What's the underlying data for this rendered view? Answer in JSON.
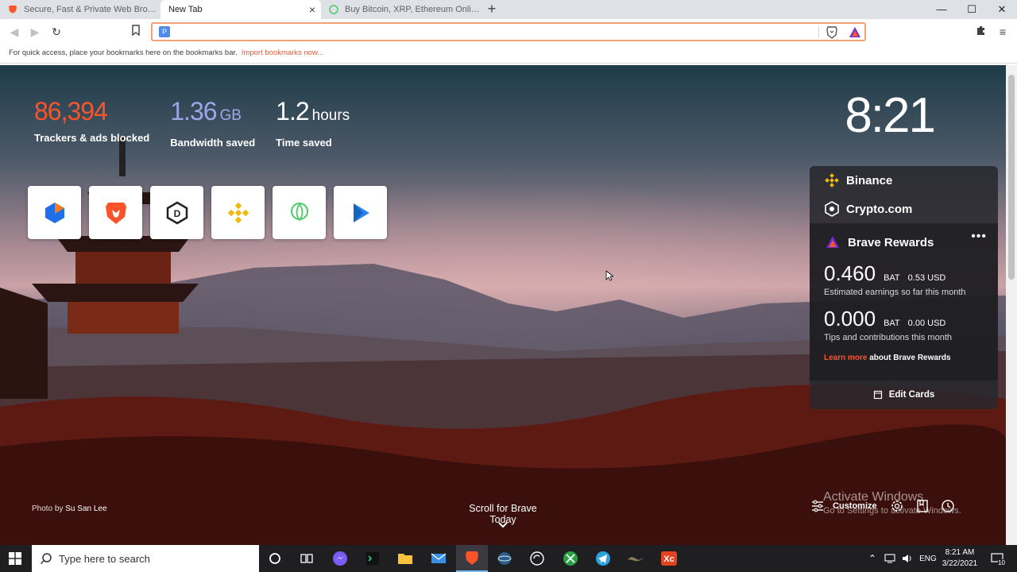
{
  "tabs": [
    {
      "title": "Secure, Fast & Private Web Browser w",
      "active": false,
      "icon": "brave-lion-icon"
    },
    {
      "title": "New Tab",
      "active": true,
      "icon": ""
    },
    {
      "title": "Buy Bitcoin, XRP, Ethereum Online - U",
      "active": false,
      "icon": "uphold-icon"
    }
  ],
  "window_controls": {
    "minimize": "—",
    "maximize": "☐",
    "close": "✕"
  },
  "omnibox": {
    "value": "",
    "placeholder": ""
  },
  "bookmarks_bar": {
    "message": "For quick access, place your bookmarks here on the bookmarks bar.",
    "import_link": "Import bookmarks now..."
  },
  "stats": {
    "trackers": {
      "value": "86,394",
      "label": "Trackers & ads blocked",
      "color": "#fb542b"
    },
    "bandwidth": {
      "value": "1.36",
      "unit": "GB",
      "label": "Bandwidth saved",
      "color": "#a0a5eb"
    },
    "time": {
      "value": "1.2",
      "unit": "hours",
      "label": "Time saved",
      "color": "#ffffff"
    }
  },
  "clock": "8:21",
  "top_sites": [
    {
      "name": "crypto-exchange-icon"
    },
    {
      "name": "brave-icon"
    },
    {
      "name": "dapp-icon"
    },
    {
      "name": "binance-icon"
    },
    {
      "name": "uphold-icon"
    },
    {
      "name": "play-icon"
    }
  ],
  "cards": {
    "binance": "Binance",
    "crypto": "Crypto.com",
    "rewards": {
      "title": "Brave Rewards",
      "more": "•••",
      "earnings_amount": "0.460",
      "earnings_currency": "BAT",
      "earnings_usd": "0.53 USD",
      "earnings_note": "Estimated earnings so far this month",
      "tips_amount": "0.000",
      "tips_currency": "BAT",
      "tips_usd": "0.00 USD",
      "tips_note": "Tips and contributions this month",
      "learn_more": "Learn more",
      "learn_more_rest": "about Brave Rewards"
    },
    "edit_cards": "Edit Cards"
  },
  "photo_credit": {
    "prefix": "Photo by",
    "author": "Su San Lee"
  },
  "scroll_today": "Scroll for Brave Today",
  "customize": "Customize",
  "activate_windows": {
    "title": "Activate Windows",
    "sub": "Go to Settings to activate Windows."
  },
  "taskbar": {
    "search_placeholder": "Type here to search",
    "lang": "ENG",
    "time": "8:21 AM",
    "date": "3/22/2021",
    "notifications": "10"
  },
  "colors": {
    "brave_orange": "#fb542b",
    "taskbar": "#1f1f22"
  }
}
